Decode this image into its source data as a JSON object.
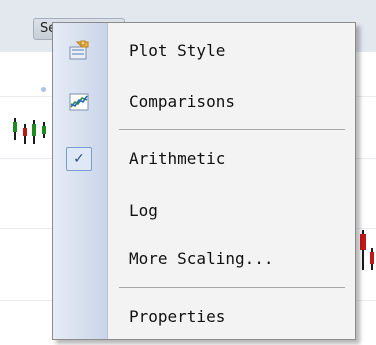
{
  "chart": {
    "tab_label": "Se"
  },
  "menu": {
    "items": [
      {
        "label": "Plot Style",
        "icon": "plot-style-icon"
      },
      {
        "label": "Comparisons",
        "icon": "comparisons-icon"
      },
      {
        "label": "Arithmetic",
        "icon": "checkmark-icon",
        "checked": true
      },
      {
        "label": "Log"
      },
      {
        "label": "More Scaling..."
      },
      {
        "label": "Properties"
      }
    ]
  }
}
